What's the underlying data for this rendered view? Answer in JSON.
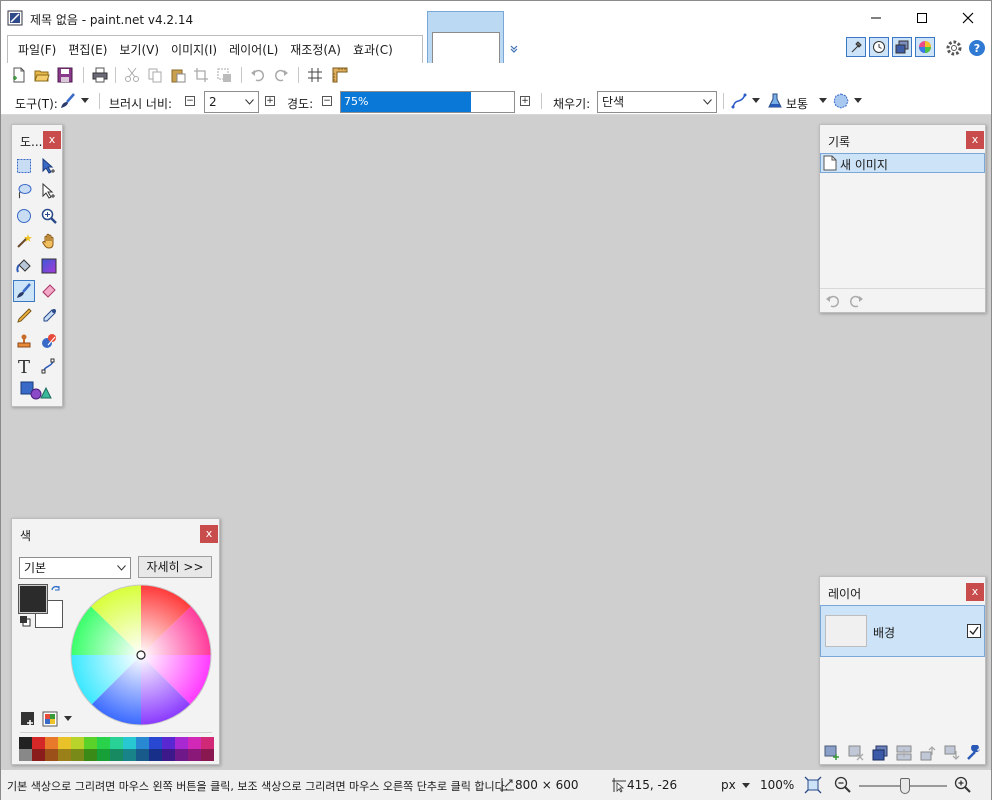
{
  "window": {
    "title": "제목 없음 - paint.net v4.2.14"
  },
  "menu": {
    "items": [
      "파일(F)",
      "편집(E)",
      "보기(V)",
      "이미지(I)",
      "레이어(L)",
      "재조정(A)",
      "효과(C)"
    ]
  },
  "toolbar": {
    "tool_label": "도구(T):",
    "brush_width_label": "브러시 너비:",
    "brush_width_value": "2",
    "hardness_label": "경도:",
    "hardness_value": "75%",
    "hardness_fraction": 0.75,
    "fill_label": "채우기:",
    "fill_value": "단색",
    "blend_mode": "보통"
  },
  "tools_panel": {
    "title": "도..."
  },
  "history_panel": {
    "title": "기록",
    "items": [
      "새 이미지"
    ]
  },
  "colors_panel": {
    "title": "색",
    "palette_select": "기본",
    "more_button": "자세히 >>",
    "primary_color": "#2b2b2b",
    "secondary_color": "#ffffff",
    "palette": [
      "#222222",
      "#d42828",
      "#e8782a",
      "#e8c228",
      "#b8d42a",
      "#5ad22a",
      "#28d24a",
      "#28d296",
      "#28c8d2",
      "#2888d2",
      "#2848d2",
      "#5a28d2",
      "#a828d2",
      "#d228b8",
      "#d22878"
    ],
    "palette_row2": [
      "#888888",
      "#8a1c1c",
      "#9a5018",
      "#9a8018",
      "#7a8a18",
      "#3a8a18",
      "#18a038",
      "#188a62",
      "#188489",
      "#185a8a",
      "#182f8a",
      "#3c188a",
      "#6e188a",
      "#8a1878",
      "#8a1850"
    ]
  },
  "layers_panel": {
    "title": "레이어",
    "layers": [
      {
        "name": "배경",
        "visible": true
      }
    ]
  },
  "statusbar": {
    "hint": "기본 색상으로 그리려면 마우스 왼쪽 버튼을 클릭, 보조 색상으로 그리려면 마우스 오른쪽 단추로 클릭 합니다.",
    "image_size": "800 × 600",
    "cursor_position": "415, -26",
    "unit": "px",
    "zoom": "100%",
    "zoom_slider_fraction": 0.52
  },
  "colors": {
    "accent": "#3b78c4",
    "selection": "#cde3f7",
    "close": "#c94c4c",
    "hardness_fill": "#0a78d7"
  }
}
